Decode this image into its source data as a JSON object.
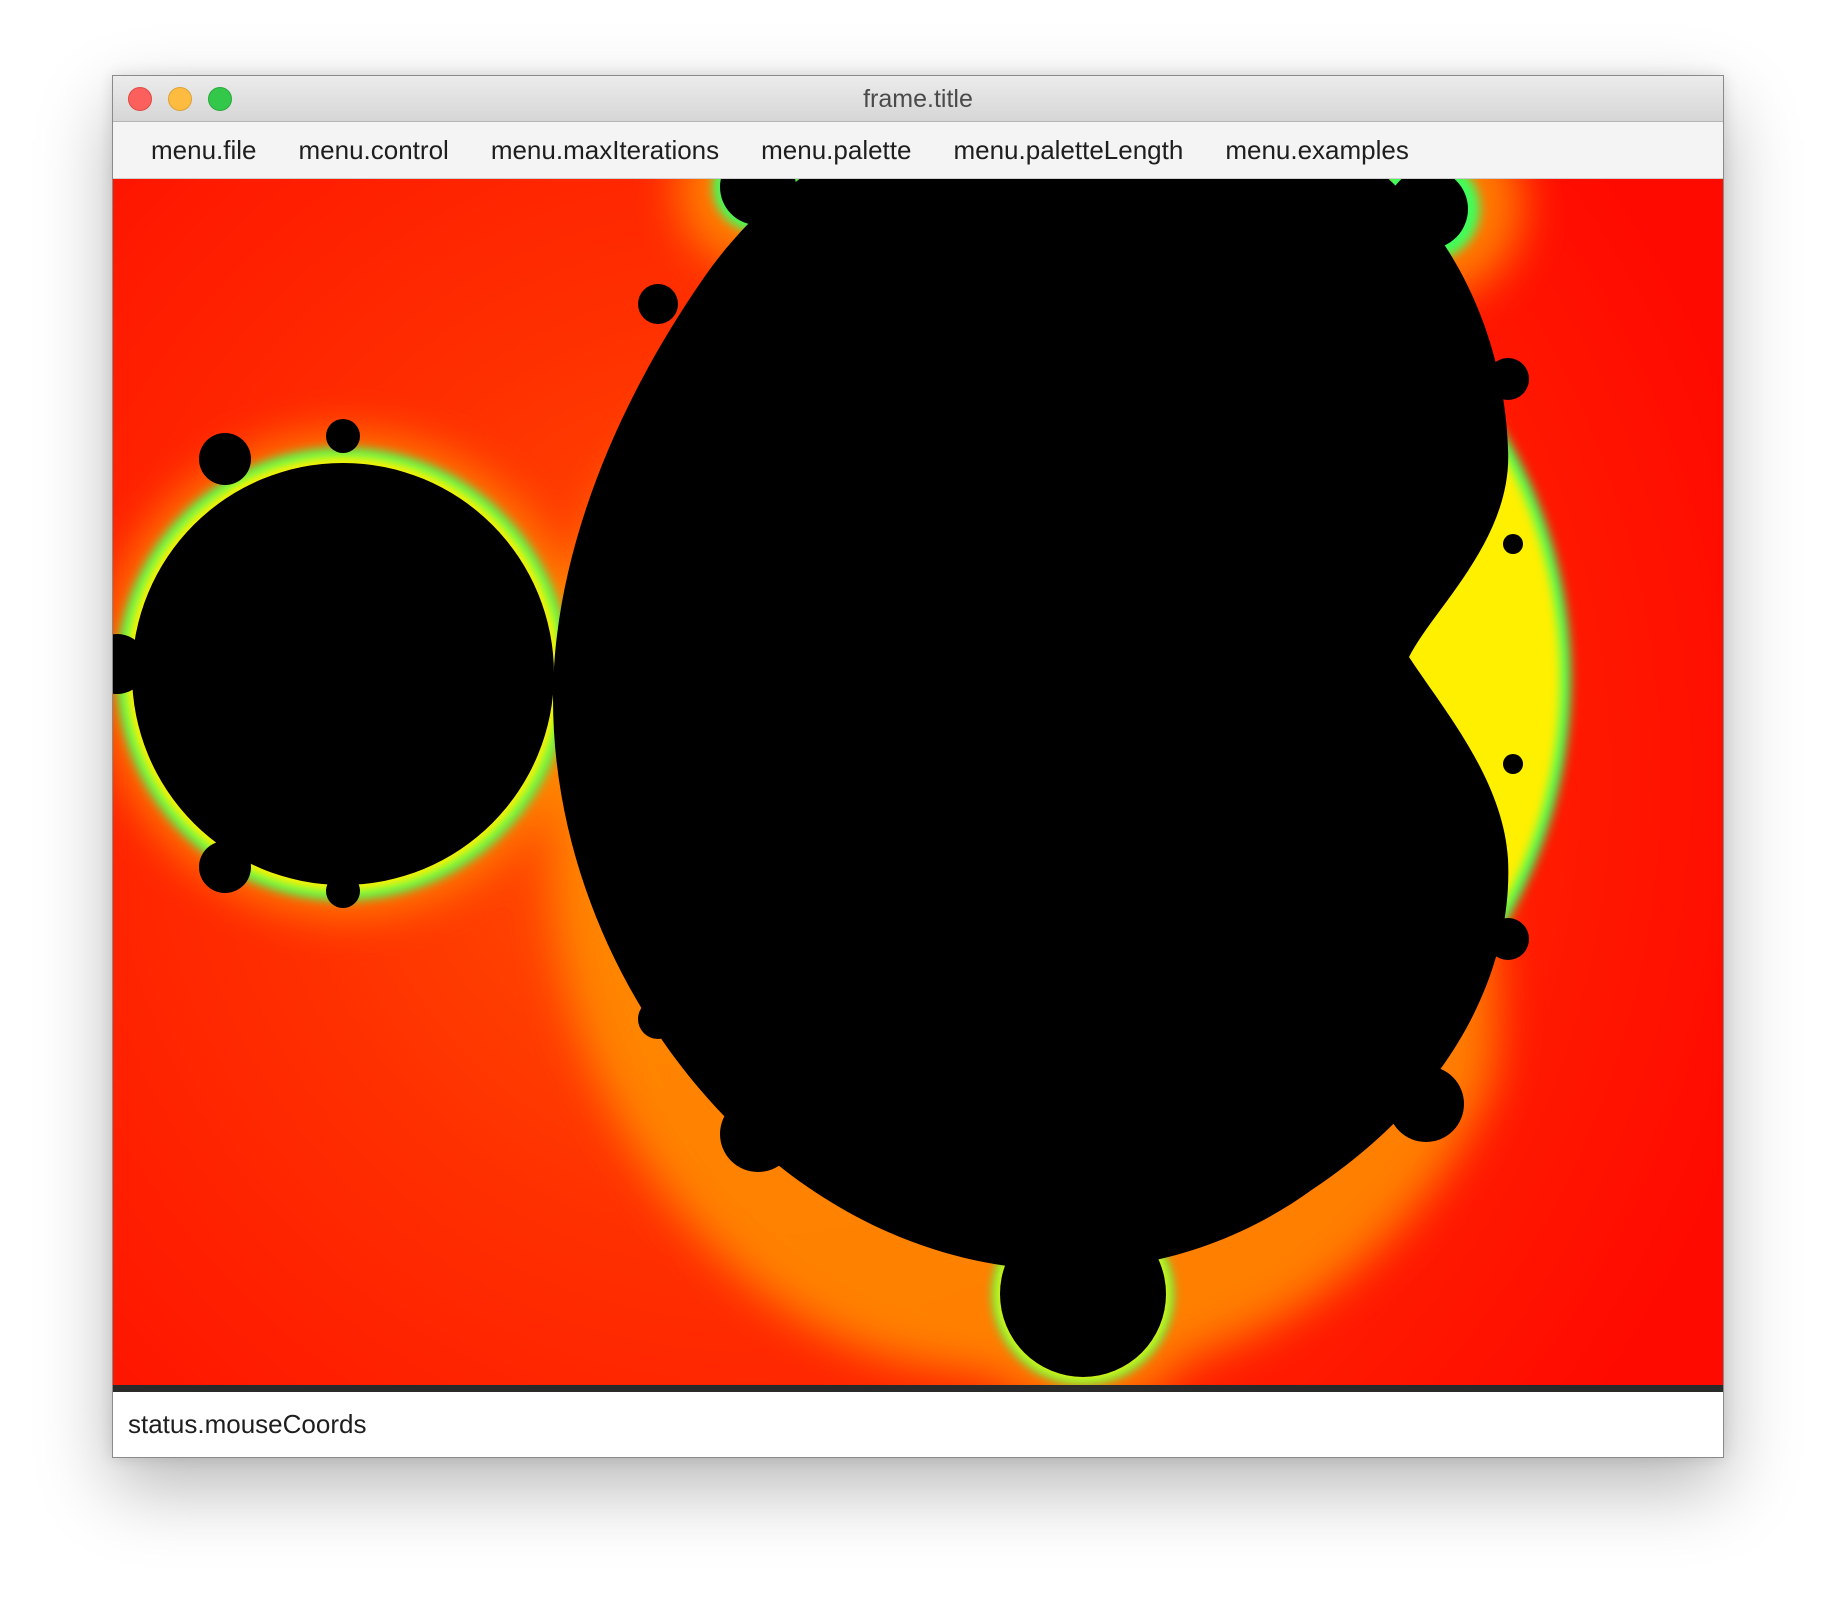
{
  "window": {
    "title": "frame.title"
  },
  "menubar": {
    "items": [
      {
        "id": "file",
        "label": "menu.file"
      },
      {
        "id": "control",
        "label": "menu.control"
      },
      {
        "id": "max-iterations",
        "label": "menu.maxIterations"
      },
      {
        "id": "palette",
        "label": "menu.palette"
      },
      {
        "id": "palette-length",
        "label": "menu.paletteLength"
      },
      {
        "id": "examples",
        "label": "menu.examples"
      }
    ]
  },
  "status": {
    "text": "status.mouseCoords"
  },
  "colors": {
    "fractal_interior": "#000000",
    "fractal_background": "#ff1a00",
    "fractal_glow": "#ff9a00",
    "fractal_edge_yellow": "#ffee00",
    "fractal_edge_green": "#44ff66"
  }
}
